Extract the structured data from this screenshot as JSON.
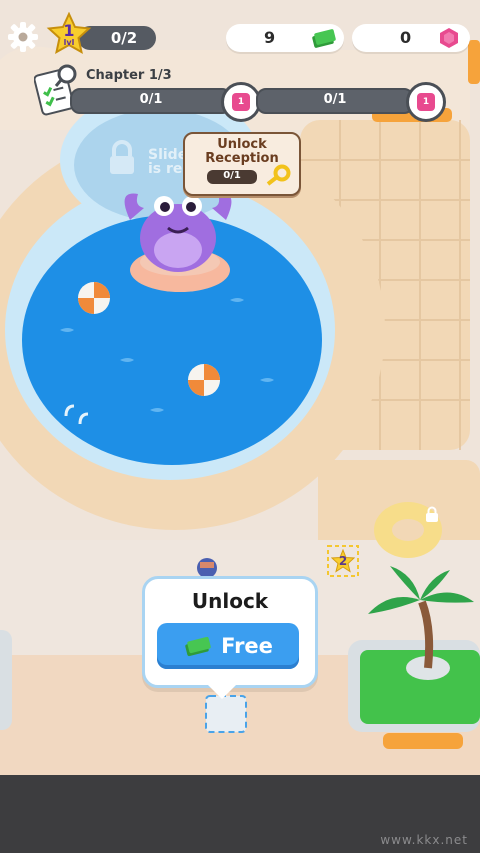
{
  "hud": {
    "level": "1",
    "level_sub": "lvl",
    "level_progress": "0/2",
    "cash": "9",
    "gems": "0"
  },
  "chapter": {
    "title": "Chapter 1/3",
    "stage1_progress": "0/1",
    "stage2_progress": "0/1",
    "node1_gem": "1",
    "node2_gem": "1"
  },
  "scene": {
    "locked_hint_line1": "Slide",
    "locked_hint_line2": "is re",
    "star_marker": "2"
  },
  "reception_card": {
    "title": "Unlock Reception",
    "progress": "0/1"
  },
  "unlock_panel": {
    "title": "Unlock",
    "button_label": "Free"
  },
  "watermark": "www.kkx.net",
  "colors": {
    "pool_water": "#1e8fe6",
    "pool_rim": "#cde8f7",
    "floor": "#f0dcc2",
    "button_blue": "#3b9ef0",
    "gem_pink": "#e84a8f",
    "cash_green": "#3fbf4a"
  }
}
